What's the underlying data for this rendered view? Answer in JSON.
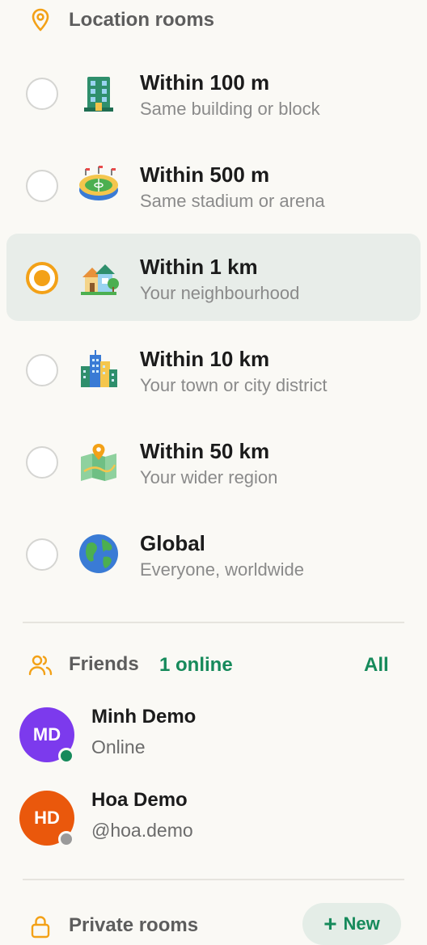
{
  "location_section": {
    "title": "Location rooms",
    "icon": "map-pin-icon"
  },
  "rooms": [
    {
      "title": "Within 100 m",
      "subtitle": "Same building or block",
      "icon": "office-building-icon",
      "selected": false
    },
    {
      "title": "Within 500 m",
      "subtitle": "Same stadium or arena",
      "icon": "stadium-icon",
      "selected": false
    },
    {
      "title": "Within 1 km",
      "subtitle": "Your neighbourhood",
      "icon": "houses-icon",
      "selected": true
    },
    {
      "title": "Within 10 km",
      "subtitle": "Your town or city district",
      "icon": "city-skyline-icon",
      "selected": false
    },
    {
      "title": "Within 50 km",
      "subtitle": "Your wider region",
      "icon": "folded-map-icon",
      "selected": false
    },
    {
      "title": "Global",
      "subtitle": "Everyone, worldwide",
      "icon": "globe-icon",
      "selected": false
    }
  ],
  "friends_section": {
    "title": "Friends",
    "online_count": "1 online",
    "all_label": "All",
    "icon": "users-icon"
  },
  "friends": [
    {
      "initials": "MD",
      "name": "Minh Demo",
      "subtitle": "Online",
      "avatar_color": "#7c3aed",
      "status_color": "#168a5b"
    },
    {
      "initials": "HD",
      "name": "Hoa Demo",
      "subtitle": "@hoa.demo",
      "avatar_color": "#ea580c",
      "status_color": "#9a9a9a"
    }
  ],
  "private_section": {
    "title": "Private rooms",
    "new_label": "New",
    "icon": "lock-icon"
  },
  "colors": {
    "accent": "#f3a117",
    "green": "#168a5b",
    "selected_bg": "#e8ede9"
  }
}
